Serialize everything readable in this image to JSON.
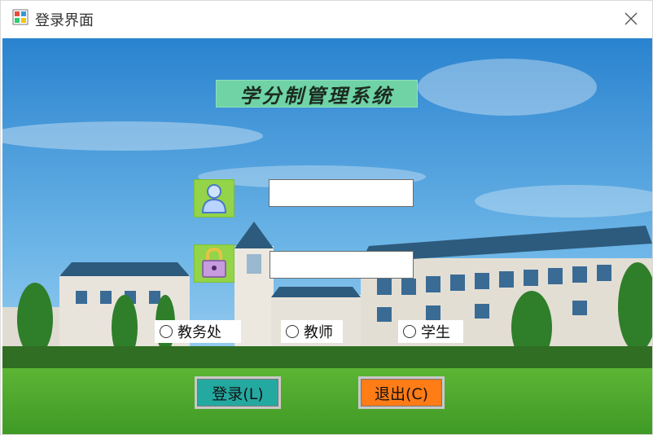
{
  "window": {
    "title": "登录界面"
  },
  "header": {
    "system_title": "学分制管理系统"
  },
  "form": {
    "username": {
      "value": "",
      "placeholder": ""
    },
    "password": {
      "value": "",
      "placeholder": ""
    }
  },
  "roles": [
    {
      "label": "教务处",
      "selected": false
    },
    {
      "label": "教师",
      "selected": false
    },
    {
      "label": "学生",
      "selected": false
    }
  ],
  "buttons": {
    "login_label": "登录(L)",
    "exit_label": "退出(C)"
  },
  "colors": {
    "title_bg": "#6fd3a6",
    "icon_tile": "#93d448",
    "login_bg": "#24a9a1",
    "exit_bg": "#ff7c16",
    "sky": "#2f8ed2"
  }
}
